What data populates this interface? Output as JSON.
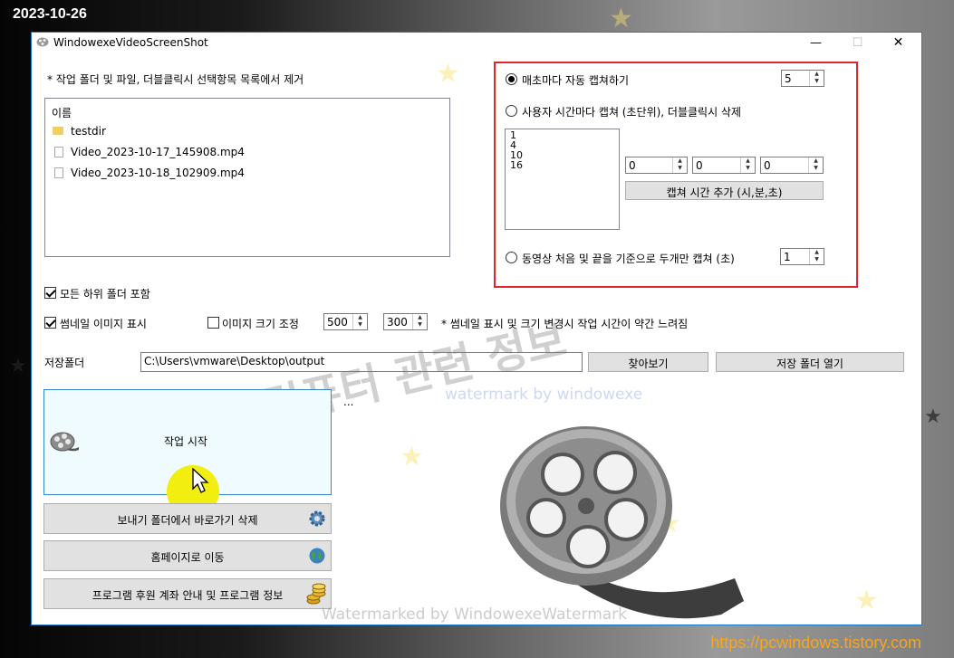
{
  "overlay": {
    "date": "2023-10-26",
    "blog_url": "https://pcwindows.tistory.com"
  },
  "window": {
    "title": "WindowexeVideoScreenShot",
    "controls": {
      "minimize": "—",
      "maximize": "☐",
      "close": "✕"
    }
  },
  "file_section": {
    "instruction": "* 작업 폴더 및 파일, 더블클릭시 선택항목 목록에서 제거",
    "column_header": "이름",
    "items": [
      {
        "type": "folder",
        "name": "testdir"
      },
      {
        "type": "file",
        "name": "Video_2023-10-17_145908.mp4"
      },
      {
        "type": "file",
        "name": "Video_2023-10-18_102909.mp4"
      }
    ]
  },
  "capture_options": {
    "auto_every_second_label": "매초마다 자동 캡쳐하기",
    "auto_every_second_value": "5",
    "custom_time_label": "사용자 시간마다 캡쳐 (초단위), 더블클릭시 삭제",
    "custom_times": [
      "1",
      "4",
      "10",
      "16"
    ],
    "time_inputs": [
      "0",
      "0",
      "0"
    ],
    "add_time_button": "캡쳐 시간 추가 (시,분,초)",
    "start_end_label": "동영상 처음 및 끝을 기준으로 두개만 캡쳐 (초)",
    "start_end_value": "1",
    "selected_option": "auto_every_second"
  },
  "options": {
    "include_subfolders": {
      "label": "모든 하위 폴더 포함",
      "checked": true
    },
    "show_thumbnail": {
      "label": "썸네일 이미지 표시",
      "checked": true
    },
    "resize_image": {
      "label": "이미지 크기 조정",
      "checked": false
    },
    "width": "500",
    "height": "300",
    "note": "* 썸네일 표시 및 크기 변경시 작업 시간이 약간 느려짐"
  },
  "save": {
    "label": "저장폴더",
    "path": "C:\\Users\\vmware\\Desktop\\output",
    "browse_button": "찾아보기",
    "open_folder_button": "저장 폴더 열기"
  },
  "actions": {
    "start_button": "작업 시작",
    "status_text": "...",
    "remove_shortcut_button": "보내기 폴더에서 바로가기 삭제",
    "homepage_button": "홈페이지로 이동",
    "donation_button": "프로그램 후원 계좌 안내 및 프로그램 정보"
  },
  "watermarks": {
    "korean": "컴퓨터 관련 정보",
    "english": "watermark by windowexe",
    "bottom": "Watermarked by WindowexeWatermark"
  },
  "colors": {
    "highlight_box": "#e0262c",
    "start_panel_bg": "#f0fbff",
    "cursor_highlight": "#f2ee10",
    "url_text": "#f5a623"
  },
  "icons": {
    "app": "film-reel-icon",
    "settings": "gear-icon",
    "homepage": "globe-icon",
    "donation": "coins-icon"
  }
}
